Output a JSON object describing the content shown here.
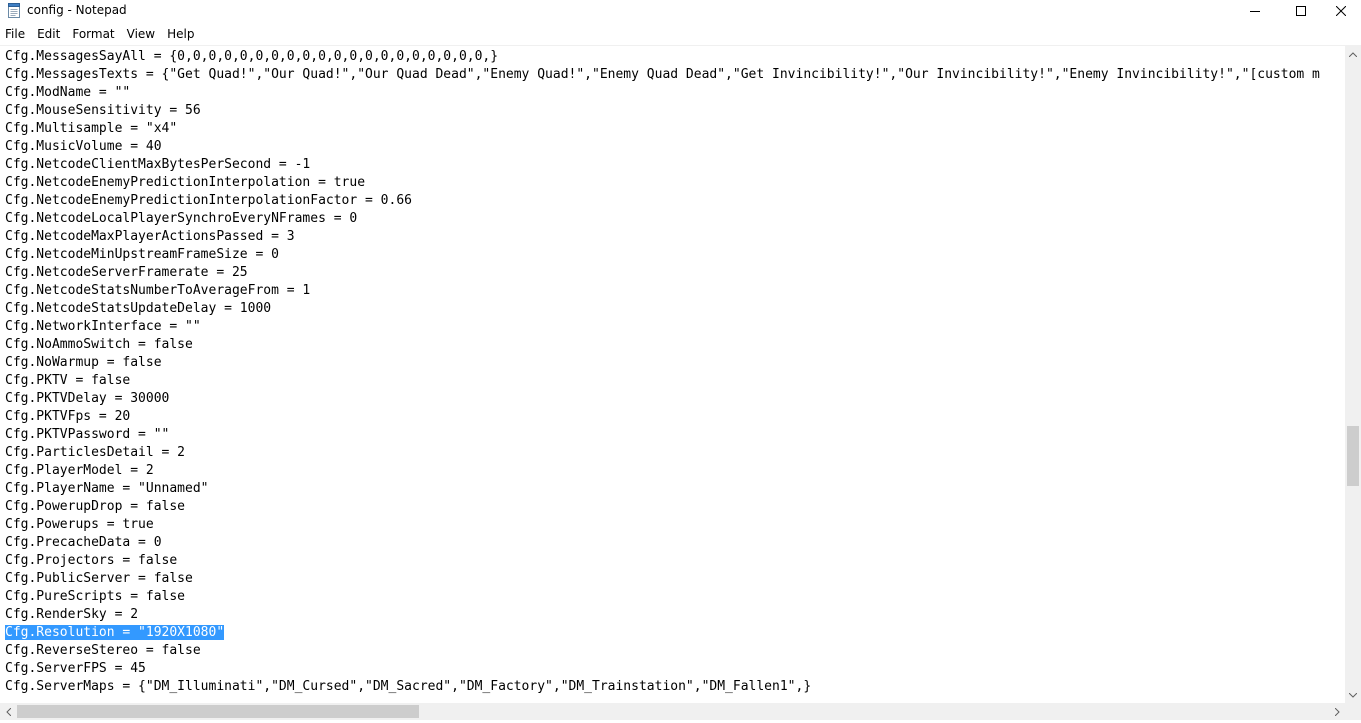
{
  "window": {
    "title": "config - Notepad"
  },
  "menu": [
    "File",
    "Edit",
    "Format",
    "View",
    "Help"
  ],
  "editor": {
    "lines": [
      "Cfg.MessagesSayAll = {0,0,0,0,0,0,0,0,0,0,0,0,0,0,0,0,0,0,0,0,}",
      "Cfg.MessagesTexts = {\"Get Quad!\",\"Our Quad!\",\"Our Quad Dead\",\"Enemy Quad!\",\"Enemy Quad Dead\",\"Get Invincibility!\",\"Our Invincibility!\",\"Enemy Invincibility!\",\"[custom m",
      "Cfg.ModName = \"\"",
      "Cfg.MouseSensitivity = 56",
      "Cfg.Multisample = \"x4\"",
      "Cfg.MusicVolume = 40",
      "Cfg.NetcodeClientMaxBytesPerSecond = -1",
      "Cfg.NetcodeEnemyPredictionInterpolation = true",
      "Cfg.NetcodeEnemyPredictionInterpolationFactor = 0.66",
      "Cfg.NetcodeLocalPlayerSynchroEveryNFrames = 0",
      "Cfg.NetcodeMaxPlayerActionsPassed = 3",
      "Cfg.NetcodeMinUpstreamFrameSize = 0",
      "Cfg.NetcodeServerFramerate = 25",
      "Cfg.NetcodeStatsNumberToAverageFrom = 1",
      "Cfg.NetcodeStatsUpdateDelay = 1000",
      "Cfg.NetworkInterface = \"\"",
      "Cfg.NoAmmoSwitch = false",
      "Cfg.NoWarmup = false",
      "Cfg.PKTV = false",
      "Cfg.PKTVDelay = 30000",
      "Cfg.PKTVFps = 20",
      "Cfg.PKTVPassword = \"\"",
      "Cfg.ParticlesDetail = 2",
      "Cfg.PlayerModel = 2",
      "Cfg.PlayerName = \"Unnamed\"",
      "Cfg.PowerupDrop = false",
      "Cfg.Powerups = true",
      "Cfg.PrecacheData = 0",
      "Cfg.Projectors = false",
      "Cfg.PublicServer = false",
      "Cfg.PureScripts = false",
      "Cfg.RenderSky = 2",
      "Cfg.Resolution = \"1920X1080\"",
      "Cfg.ReverseStereo = false",
      "Cfg.ServerFPS = 45",
      "Cfg.ServerMaps = {\"DM_Illuminati\",\"DM_Cursed\",\"DM_Sacred\",\"DM_Factory\",\"DM_Trainstation\",\"DM_Fallen1\",}"
    ],
    "selected_line": 32,
    "selection_color": "#3399ff"
  },
  "icons": {
    "app": "notepad-icon",
    "minimize": "minimize-icon",
    "maximize": "maximize-icon",
    "close": "close-icon"
  }
}
